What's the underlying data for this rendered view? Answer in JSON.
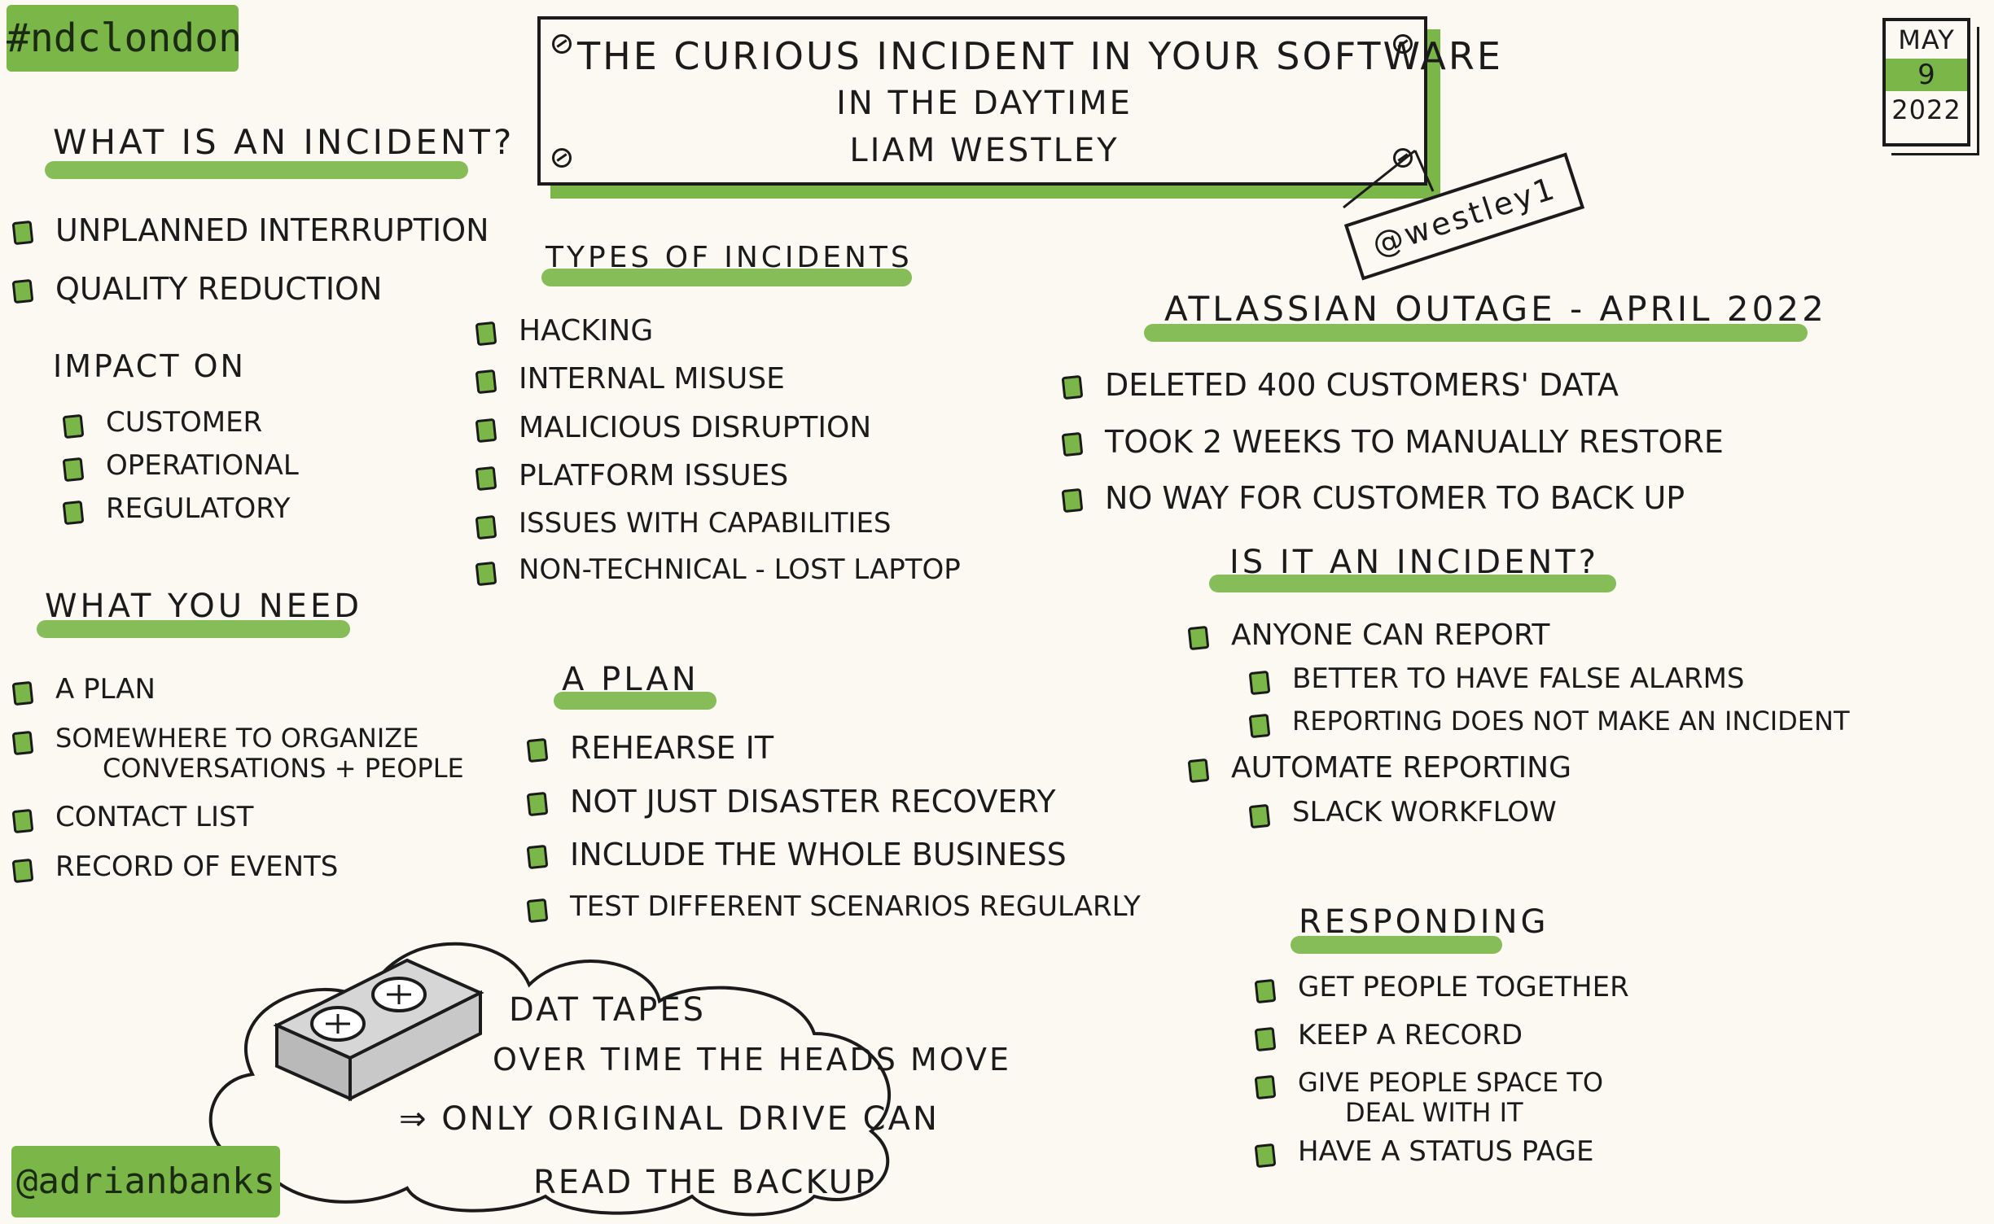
{
  "hashtag": "#ndclondon",
  "author_handle": "@adrianbanks",
  "title": {
    "line1": "THE CURIOUS INCIDENT IN YOUR SOFTWARE",
    "line2": "IN THE DAYTIME",
    "speaker": "LIAM WESTLEY"
  },
  "speaker_tag": "@westley1",
  "date": {
    "month": "MAY",
    "day": "9",
    "year": "2022"
  },
  "what_is_incident": {
    "heading": "WHAT IS AN INCIDENT?",
    "items": [
      "UNPLANNED INTERRUPTION",
      "QUALITY REDUCTION"
    ],
    "impact_label": "IMPACT ON",
    "impact_items": [
      "CUSTOMER",
      "OPERATIONAL",
      "REGULATORY"
    ]
  },
  "what_you_need": {
    "heading": "WHAT YOU NEED",
    "items": [
      "A PLAN",
      "SOMEWHERE TO ORGANIZE",
      "CONVERSATIONS + PEOPLE",
      "CONTACT LIST",
      "RECORD OF EVENTS"
    ]
  },
  "types_of_incidents": {
    "heading": "TYPES OF INCIDENTS",
    "items": [
      "HACKING",
      "INTERNAL MISUSE",
      "MALICIOUS DISRUPTION",
      "PLATFORM ISSUES",
      "ISSUES WITH CAPABILITIES",
      "NON-TECHNICAL - LOST LAPTOP"
    ]
  },
  "a_plan": {
    "heading": "A PLAN",
    "items": [
      "REHEARSE IT",
      "NOT JUST DISASTER RECOVERY",
      "INCLUDE THE WHOLE BUSINESS",
      "TEST DIFFERENT SCENARIOS REGULARLY"
    ]
  },
  "atlassian": {
    "heading": "ATLASSIAN OUTAGE - APRIL 2022",
    "items": [
      "DELETED 400 CUSTOMERS' DATA",
      "TOOK 2 WEEKS TO MANUALLY RESTORE",
      "NO WAY FOR CUSTOMER TO BACK UP"
    ]
  },
  "is_it_incident": {
    "heading": "IS IT AN INCIDENT?",
    "items": [
      "ANYONE CAN REPORT",
      "BETTER TO HAVE FALSE ALARMS",
      "REPORTING DOES NOT MAKE AN INCIDENT",
      "AUTOMATE REPORTING",
      "SLACK WORKFLOW"
    ]
  },
  "responding": {
    "heading": "RESPONDING",
    "items": [
      "GET PEOPLE TOGETHER",
      "KEEP A RECORD",
      "GIVE PEOPLE SPACE TO",
      "DEAL WITH IT",
      "HAVE A STATUS PAGE"
    ]
  },
  "dat_tapes": {
    "line1": "DAT TAPES",
    "line2": "OVER TIME THE HEADS MOVE",
    "line3": "⇒ ONLY ORIGINAL DRIVE CAN",
    "line4": "READ THE BACKUP"
  },
  "colors": {
    "accent": "#7ab648",
    "ink": "#1b1b1b",
    "paper": "#fbf9f2"
  }
}
